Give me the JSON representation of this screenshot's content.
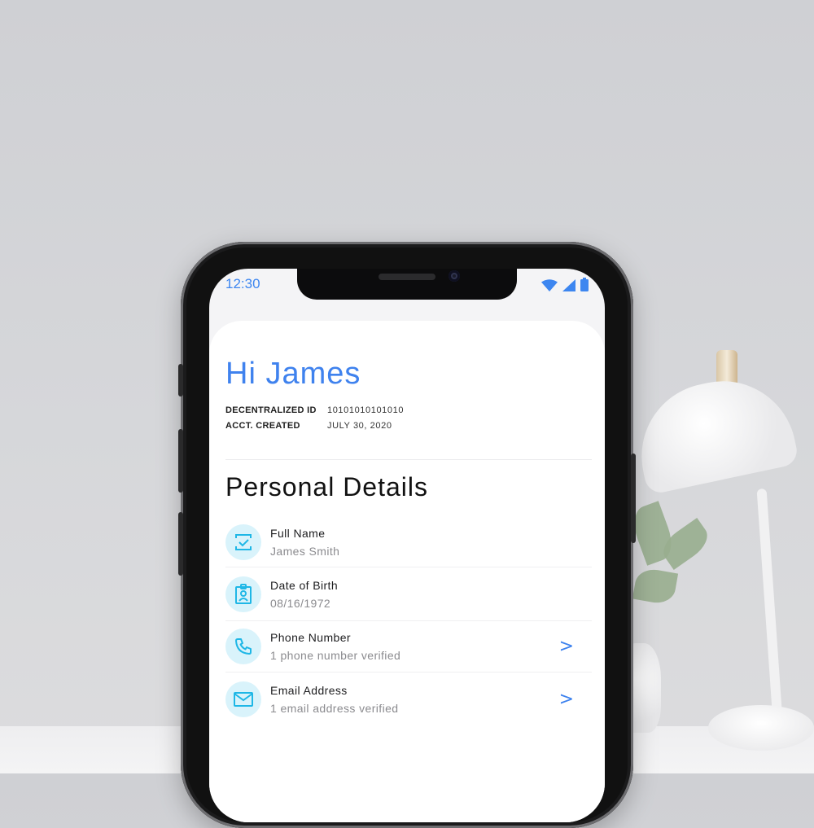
{
  "status_bar": {
    "time": "12:30"
  },
  "profile": {
    "greeting": "Hi James",
    "meta": [
      {
        "label": "DECENTRALIZED ID",
        "value": "10101010101010"
      },
      {
        "label": "ACCT. CREATED",
        "value": "JULY 30, 2020"
      }
    ]
  },
  "personal_details": {
    "title": "Personal Details",
    "items": [
      {
        "title": "Full Name",
        "subtitle": "James Smith",
        "icon": "id-check-icon"
      },
      {
        "title": "Date of Birth",
        "subtitle": "08/16/1972",
        "icon": "badge-icon"
      },
      {
        "title": "Phone Number",
        "subtitle": "1 phone number verified",
        "icon": "phone-icon",
        "chevron": ">"
      },
      {
        "title": "Email Address",
        "subtitle": "1 email address verified",
        "icon": "mail-icon",
        "chevron": ">"
      }
    ]
  },
  "colors": {
    "accent": "#3f82ee",
    "icon_bg": "#d9f3fb",
    "icon_stroke": "#1fb7e6"
  }
}
